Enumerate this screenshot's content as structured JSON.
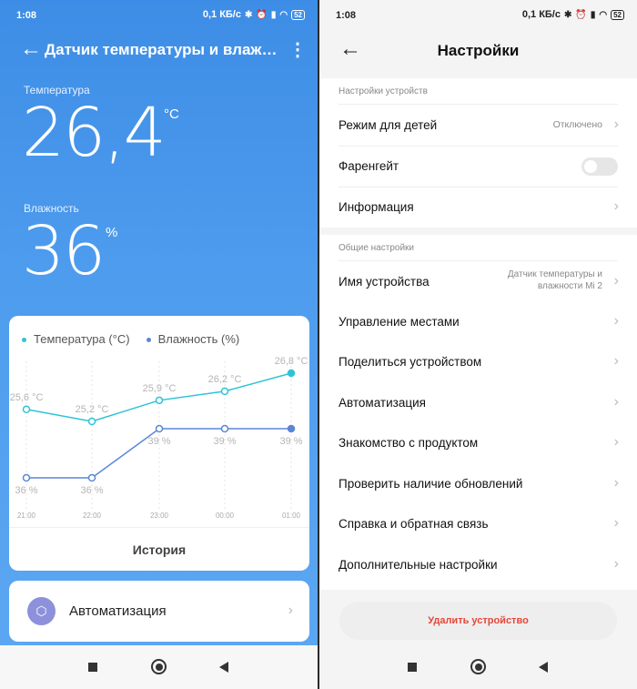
{
  "status": {
    "left_time": "1:08",
    "right_time": "1:08",
    "speed": "0,1 КБ/с",
    "battery": "52",
    "icons": [
      "bluetooth-icon",
      "alarm-icon",
      "signal-icon",
      "wifi-icon",
      "battery-icon"
    ]
  },
  "left": {
    "title": "Датчик температуры и влажнос...",
    "temperature_label": "Температура",
    "temperature_value": "26,4",
    "temperature_unit": "°C",
    "humidity_label": "Влажность",
    "humidity_value": "36",
    "humidity_unit": "%",
    "history_label": "История",
    "automation_label": "Автоматизация"
  },
  "chart_data": {
    "type": "line",
    "categories": [
      "21:00",
      "22:00",
      "23:00",
      "00:00",
      "01:00"
    ],
    "series": [
      {
        "name": "Температура (°C)",
        "values": [
          25.6,
          25.2,
          25.9,
          26.2,
          26.8
        ],
        "labels": [
          "25,6 °C",
          "25,2 °C",
          "25,9 °C",
          "26,2 °C",
          "26,8 °C"
        ],
        "color": "#2ec4d6"
      },
      {
        "name": "Влажность (%)",
        "values": [
          36,
          36,
          39,
          39,
          39
        ],
        "labels": [
          "36 %",
          "36 %",
          "39 %",
          "39 %",
          "39 %"
        ],
        "color": "#5b86d6"
      }
    ],
    "legend": "top-left"
  },
  "right": {
    "title": "Настройки",
    "device_section": "Настройки устройств",
    "general_section": "Общие настройки",
    "rows": {
      "kids_mode": {
        "label": "Режим для детей",
        "value": "Отключено"
      },
      "fahrenheit": {
        "label": "Фаренгейт"
      },
      "info": {
        "label": "Информация"
      },
      "device_name": {
        "label": "Имя устройства",
        "value_line1": "Датчик температуры и",
        "value_line2": "влажности Mi 2"
      },
      "places": {
        "label": "Управление местами"
      },
      "share": {
        "label": "Поделиться устройством"
      },
      "automation": {
        "label": "Автоматизация"
      },
      "intro": {
        "label": "Знакомство с продуктом"
      },
      "updates": {
        "label": "Проверить наличие обновлений"
      },
      "help": {
        "label": "Справка и обратная связь"
      },
      "extra": {
        "label": "Дополнительные настройки"
      }
    },
    "delete_label": "Удалить устройство"
  },
  "colors": {
    "accent_blue": "#4e9cee",
    "temp_line": "#2ec4d6",
    "humidity_line": "#5b86d6",
    "delete_red": "#e5473a"
  }
}
